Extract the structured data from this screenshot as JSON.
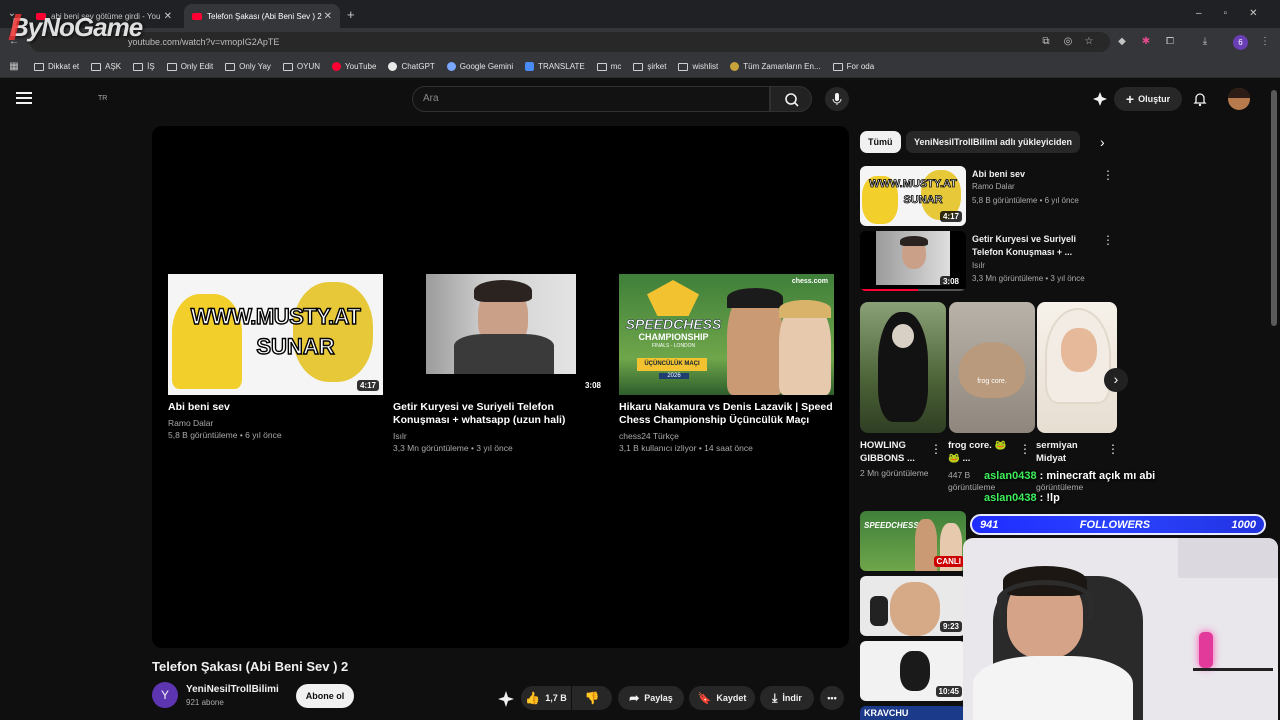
{
  "watermark": "ByNoGame",
  "browser": {
    "tabs": [
      {
        "label": "abi beni sev götüme girdi - You"
      },
      {
        "label": "Telefon Şakası (Abi Beni Sev ) 2"
      }
    ],
    "url": "youtube.com/watch?v=vmopIG2ApTE",
    "bookmarks": [
      "Dikkat et",
      "AŞK",
      "İŞ",
      "Only Edit",
      "Only Yay",
      "OYUN",
      "YouTube",
      "ChatGPT",
      "Google Gemini",
      "TRANSLATE",
      "mc",
      "şirket",
      "wishlist",
      "Tüm Zamanların En...",
      "For oda"
    ],
    "profile_initial": "6"
  },
  "header": {
    "region": "TR",
    "search_placeholder": "Ara",
    "create_label": "Oluştur"
  },
  "endscreen": [
    {
      "title": "Abi beni sev",
      "channel": "Ramo Dalar",
      "meta": "5,8 B görüntüleme • 6 yıl önce",
      "duration": "4:17",
      "thumb_text_1": "WWW.MUSTY.AT",
      "thumb_text_2": "SUNAR"
    },
    {
      "title": "Getir Kuryesi ve Suriyeli Telefon Konuşması + whatsapp (uzun hali)",
      "channel": "Isılr",
      "meta": "3,3 Mn görüntüleme • 3 yıl önce",
      "duration": "3:08"
    },
    {
      "title": "Hikaru Nakamura vs Denis Lazavik | Speed Chess Championship Üçüncülük Maçı",
      "channel": "chess24 Türkçe",
      "meta": "3,1 B kullanıcı izliyor • 14 saat önce",
      "thumb_text_1": "SPEEDCHESS",
      "thumb_text_2": "CHAMPIONSHIP",
      "thumb_text_3": "FINALS - LONDON",
      "thumb_text_4": "ÜÇÜNCÜLÜK MAÇI",
      "thumb_text_5": "2026",
      "thumb_brand": "chess.com"
    }
  ],
  "video": {
    "title": "Telefon Şakası (Abi Beni Sev ) 2",
    "channel": "YeniNesilTrollBilimi",
    "channel_initial": "Y",
    "subscribers": "921 abone",
    "subscribe_label": "Abone ol",
    "likes": "1,7 B",
    "share_label": "Paylaş",
    "save_label": "Kaydet",
    "download_label": "İndir"
  },
  "sidebar": {
    "chips": [
      "Tümü",
      "YeniNesilTrollBilimi adlı yükleyiciden"
    ],
    "recs": [
      {
        "title": "Abi beni sev",
        "channel": "Ramo Dalar",
        "meta": "5,8 B görüntüleme • 6 yıl önce",
        "duration": "4:17",
        "thumb_text_1": "WWW.MUSTY.AT",
        "thumb_text_2": "SUNAR"
      },
      {
        "title": "Getir Kuryesi ve Suriyeli Telefon Konuşması + ...",
        "channel": "Isılr",
        "meta": "3,3 Mn görüntüleme • 3 yıl önce",
        "duration": "3:08"
      }
    ],
    "shorts": [
      {
        "title": "HOWLING GIBBONS ...",
        "meta": "2 Mn görüntüleme"
      },
      {
        "title": "frog core. 🐸 🐸 ...",
        "meta": "447 B görüntüleme",
        "overlay": "frog core."
      },
      {
        "title": "sermiyan Midyat",
        "meta": "görüntüleme"
      }
    ],
    "more_thumbs": [
      {
        "badge": "CANLI",
        "thumb_text": "SPEEDCHESS"
      },
      {
        "duration": "9:23"
      },
      {
        "duration": "10:45"
      },
      {
        "thumb_text": "KRAVCHU"
      }
    ]
  },
  "stream": {
    "chat": [
      {
        "user": "aslan0438",
        "message": "minecraft açık mı abi"
      },
      {
        "user": "aslan0438",
        "message": "!lp"
      }
    ],
    "followers_label": "FOLLOWERS",
    "followers_current": "941",
    "followers_goal": "1000",
    "followers_progress": 0.941
  }
}
